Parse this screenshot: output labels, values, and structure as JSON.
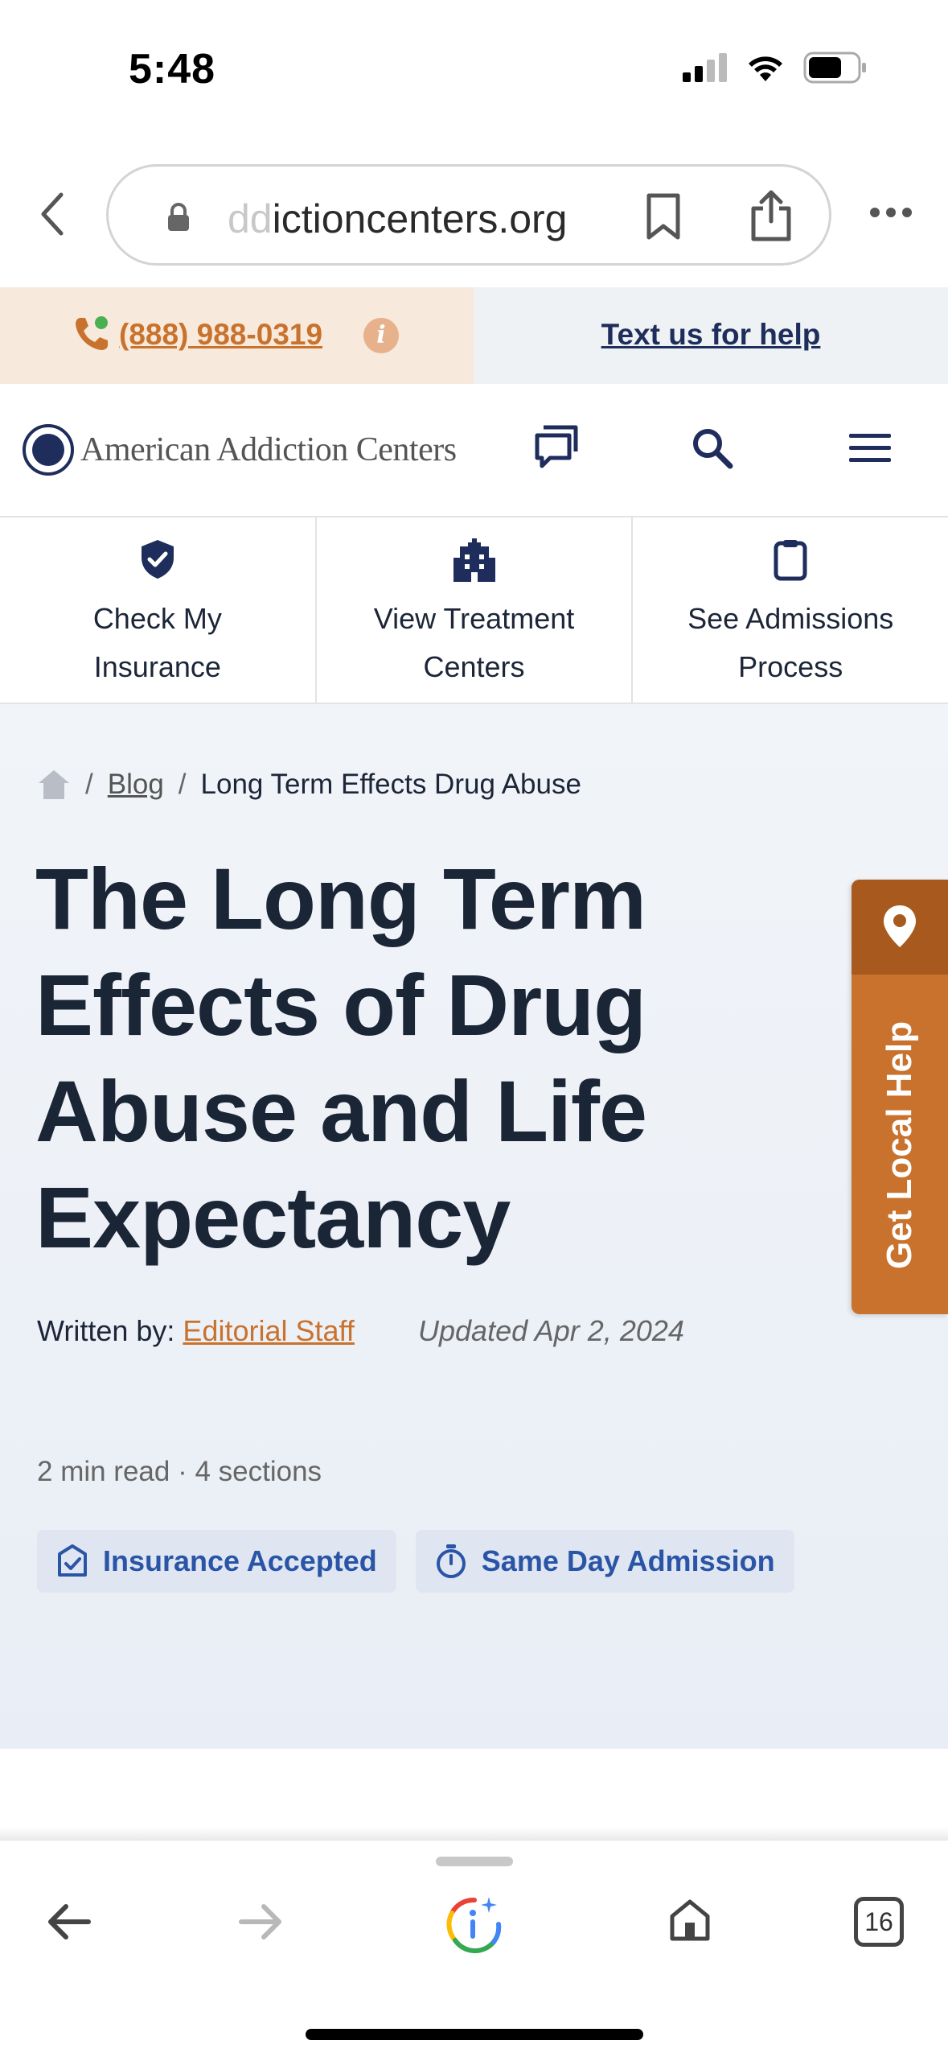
{
  "status_bar": {
    "time": "5:48"
  },
  "browser": {
    "url_faded": "dd",
    "url_main": "ictioncenters.org",
    "tab_count": "16"
  },
  "help_strip": {
    "phone": "(888) 988-0319",
    "text_us": "Text us for help"
  },
  "site": {
    "logo_text": "American Addiction Centers"
  },
  "quick_links": [
    {
      "line1": "Check My",
      "line2": "Insurance"
    },
    {
      "line1": "View Treatment",
      "line2": "Centers"
    },
    {
      "line1": "See Admissions",
      "line2": "Process"
    }
  ],
  "breadcrumb": {
    "blog": "Blog",
    "current": "Long Term Effects Drug Abuse"
  },
  "article": {
    "title": "The Long Term Effects of Drug Abuse and Life Expectancy",
    "written_by_label": "Written by:",
    "author": "Editorial Staff",
    "updated": "Updated Apr 2, 2024",
    "read_meta": "2 min read · 4 sections",
    "badges": [
      {
        "label": "Insurance Accepted",
        "icon": "shield-check-icon"
      },
      {
        "label": "Same Day Admission",
        "icon": "stopwatch-icon"
      }
    ]
  },
  "side_tab": {
    "label": "Get Local Help"
  },
  "colors": {
    "accent_orange": "#c9722d",
    "navy": "#1f2d5c",
    "badge_blue": "#2a55a6",
    "title": "#1a2536"
  }
}
